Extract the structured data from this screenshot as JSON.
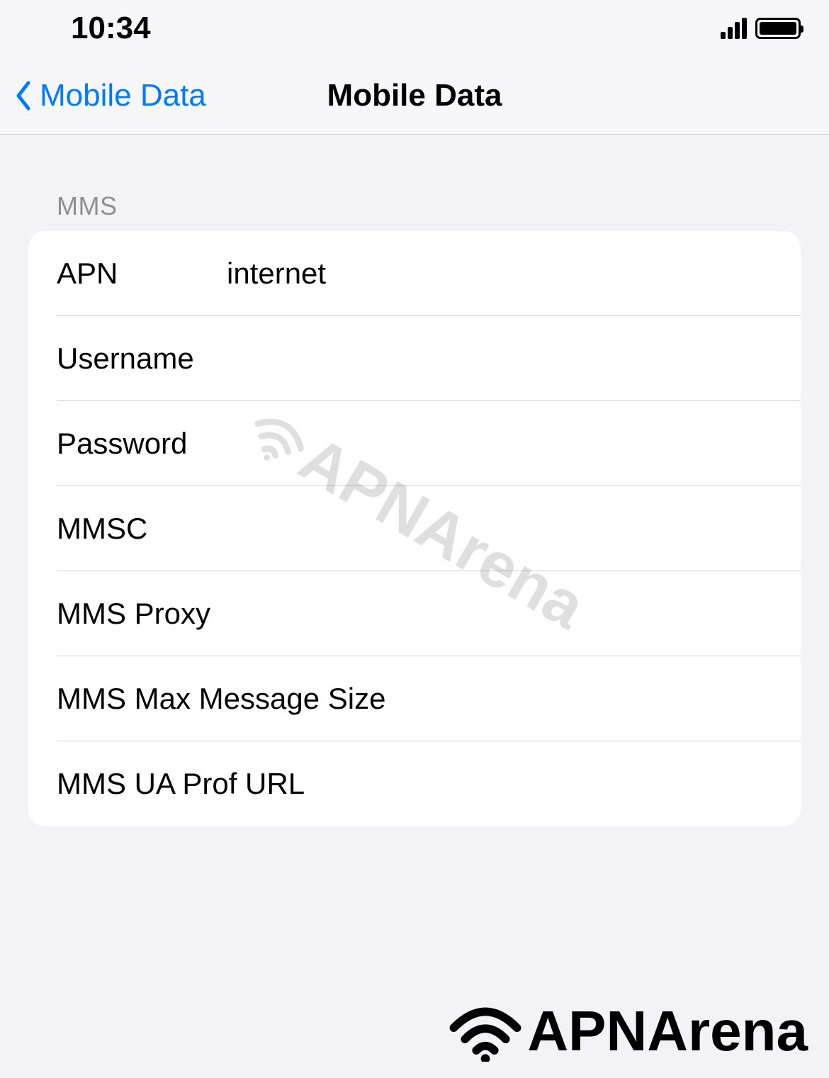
{
  "statusbar": {
    "time": "10:34"
  },
  "navbar": {
    "back_label": "Mobile Data",
    "title": "Mobile Data"
  },
  "section": {
    "header": "MMS",
    "rows": [
      {
        "label": "APN",
        "value": "internet"
      },
      {
        "label": "Username",
        "value": ""
      },
      {
        "label": "Password",
        "value": ""
      },
      {
        "label": "MMSC",
        "value": ""
      },
      {
        "label": "MMS Proxy",
        "value": ""
      },
      {
        "label": "MMS Max Message Size",
        "value": ""
      },
      {
        "label": "MMS UA Prof URL",
        "value": ""
      }
    ]
  },
  "watermark": {
    "text": "APNArena"
  }
}
